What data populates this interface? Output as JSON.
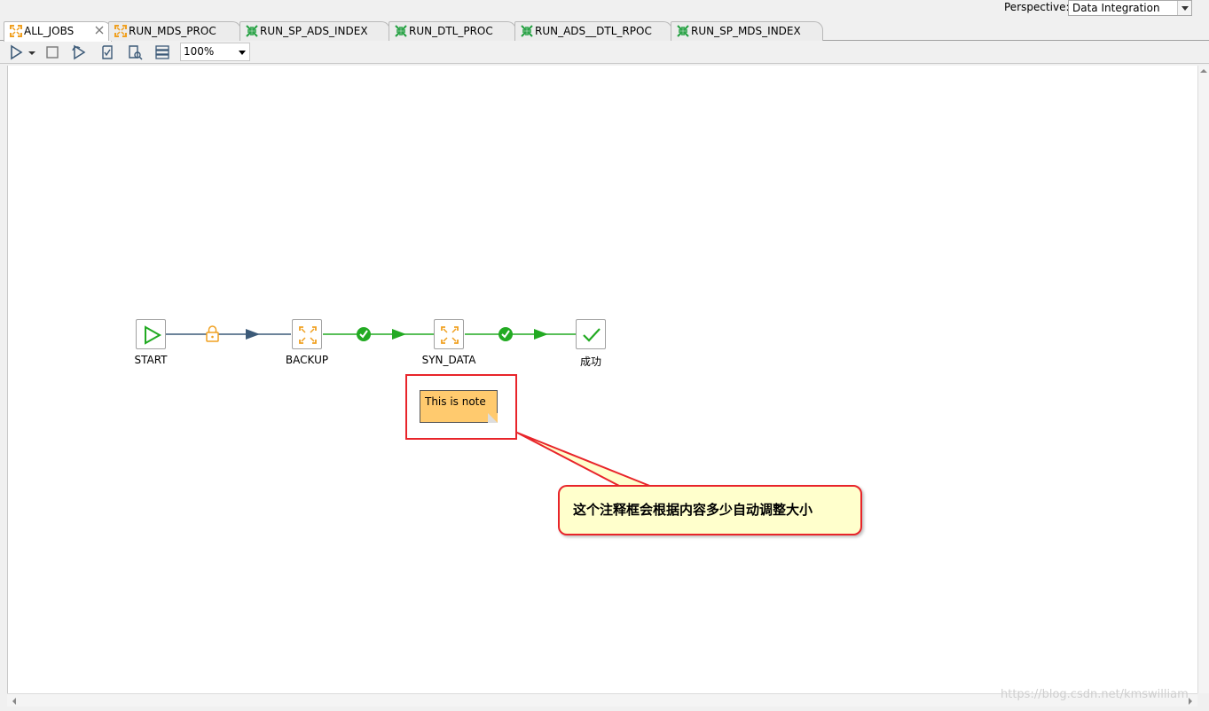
{
  "perspective": {
    "label": "Perspective:",
    "value": "Data Integration"
  },
  "tabs": [
    {
      "label": "ALL_JOBS",
      "icon": "job-orange-icon",
      "active": true
    },
    {
      "label": "RUN_MDS_PROC",
      "icon": "job-orange-icon",
      "active": false
    },
    {
      "label": "RUN_SP_ADS_INDEX",
      "icon": "transformation-green-icon",
      "active": false
    },
    {
      "label": "RUN_DTL_PROC",
      "icon": "transformation-green-icon",
      "active": false
    },
    {
      "label": "RUN_ADS__DTL_RPOC",
      "icon": "transformation-green-icon",
      "active": false
    },
    {
      "label": "RUN_SP_MDS_INDEX",
      "icon": "transformation-green-icon",
      "active": false
    }
  ],
  "toolbar": {
    "zoom": "100%",
    "buttons": [
      "run-icon",
      "run-dropdown-icon",
      "stop-icon",
      "replay-icon",
      "verify-icon",
      "sql-icon",
      "layout-icon"
    ]
  },
  "flow": {
    "nodes": [
      {
        "id": "start",
        "label": "START",
        "icon": "start-icon"
      },
      {
        "id": "backup",
        "label": "BACKUP",
        "icon": "job-entry-icon"
      },
      {
        "id": "syn_data",
        "label": "SYN_DATA",
        "icon": "job-entry-icon"
      },
      {
        "id": "success",
        "label": "成功",
        "icon": "success-check-icon"
      }
    ],
    "hops": [
      {
        "from": "start",
        "to": "backup",
        "condition": "unconditional",
        "marker": "lock-icon"
      },
      {
        "from": "backup",
        "to": "syn_data",
        "condition": "success",
        "marker": "check-circle-icon"
      },
      {
        "from": "syn_data",
        "to": "success",
        "condition": "success",
        "marker": "check-circle-icon"
      }
    ]
  },
  "note": {
    "text": "This is note"
  },
  "callout": {
    "text": "这个注释框会根据内容多少自动调整大小"
  },
  "watermark": "https://blog.csdn.net/kmswilliam",
  "colors": {
    "accent_red": "#e8242a",
    "note_fill": "#ffca6e",
    "callout_fill": "#ffffcc",
    "success_green": "#22aa22",
    "hop_blue": "#3c5a78",
    "lock_orange": "#f0a020"
  }
}
